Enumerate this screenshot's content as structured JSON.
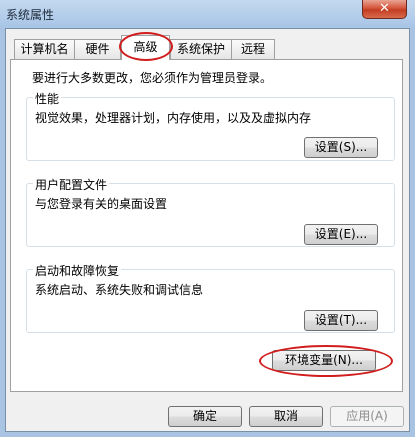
{
  "window": {
    "title": "系统属性",
    "close_label": "✕"
  },
  "tabs": [
    {
      "label": "计算机名"
    },
    {
      "label": "硬件"
    },
    {
      "label": "高级"
    },
    {
      "label": "系统保护"
    },
    {
      "label": "远程"
    }
  ],
  "advanced": {
    "admin_notice": "要进行大多数更改，您必须作为管理员登录。",
    "performance": {
      "title": "性能",
      "description": "视觉效果，处理器计划，内存使用，以及及虚拟内存",
      "button": "设置(S)..."
    },
    "user_profiles": {
      "title": "用户配置文件",
      "description": "与您登录有关的桌面设置",
      "button": "设置(E)..."
    },
    "startup_recovery": {
      "title": "启动和故障恢复",
      "description": "系统启动、系统失败和调试信息",
      "button": "设置(T)..."
    },
    "env_vars_button": "环境变量(N)..."
  },
  "footer": {
    "ok": "确定",
    "cancel": "取消",
    "apply": "应用(A)"
  },
  "colors": {
    "highlight_circle": "#d11d1d",
    "title_bar": "#b6cfeb",
    "close_button": "#c94a2e"
  }
}
